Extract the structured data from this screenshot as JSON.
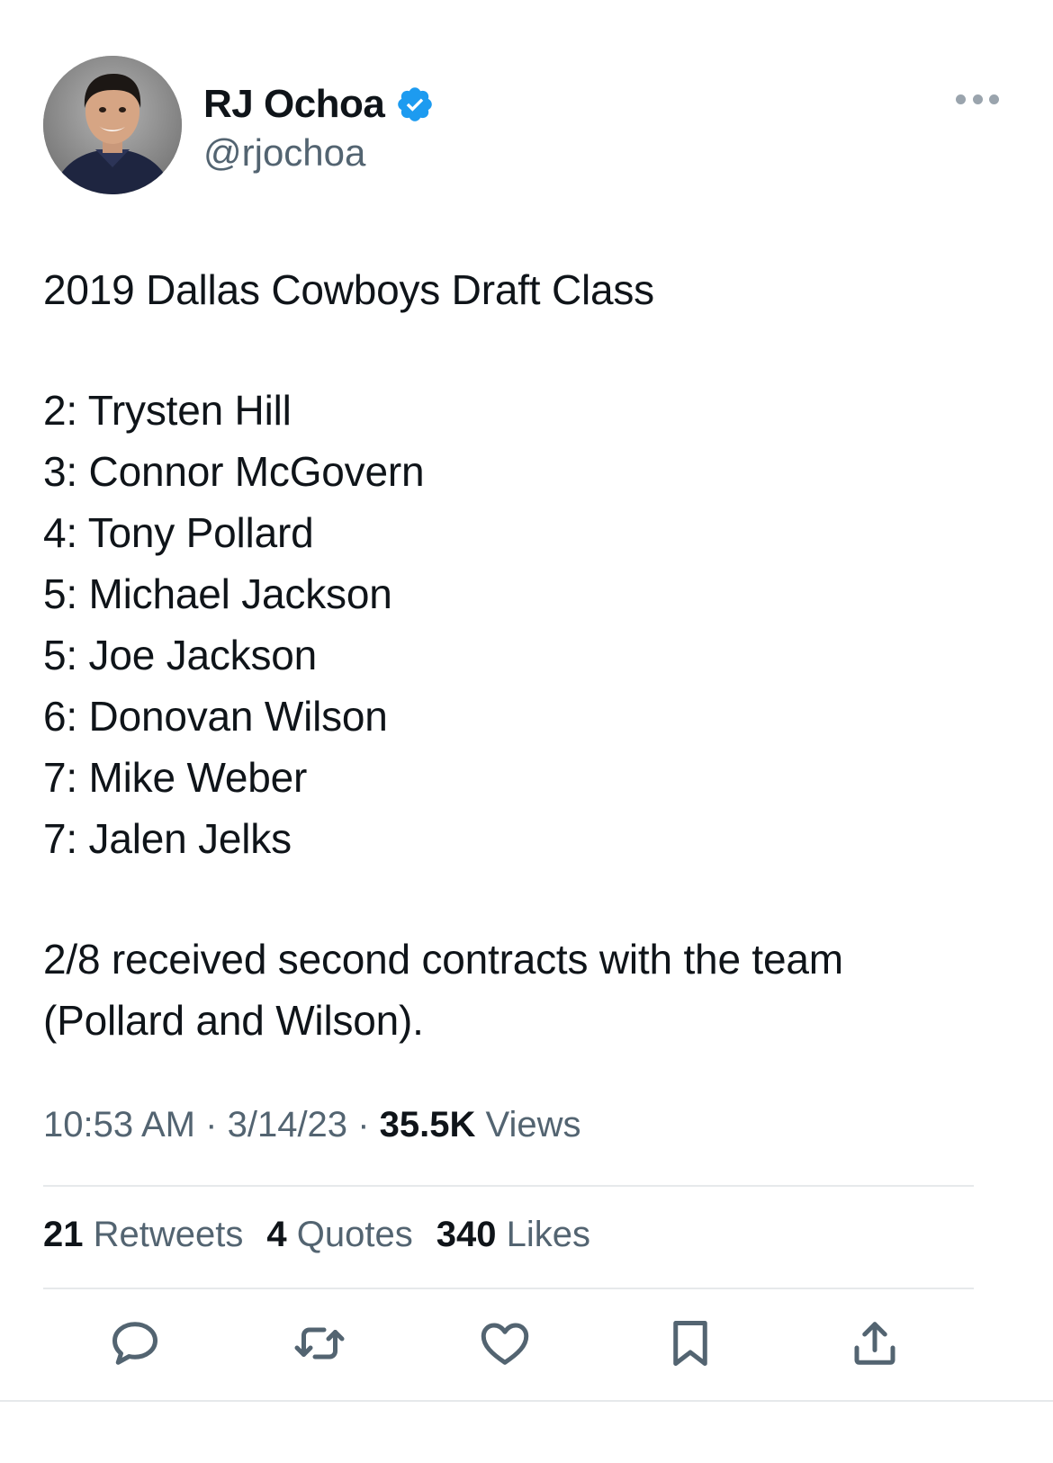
{
  "tweet": {
    "author": {
      "display_name": "RJ Ochoa",
      "handle": "@rjochoa",
      "verified": true
    },
    "text": {
      "headline": "2019 Dallas Cowboys Draft Class",
      "picks": [
        "2: Trysten Hill",
        "3: Connor McGovern",
        "4: Tony Pollard",
        "5: Michael Jackson",
        "5: Joe Jackson",
        "6: Donovan Wilson",
        "7: Mike Weber",
        "7: Jalen Jelks"
      ],
      "closing": [
        "2/8 received second contracts with the team",
        "(Pollard and Wilson)."
      ]
    },
    "meta": {
      "time": "10:53 AM",
      "separator": "·",
      "date": "3/14/23",
      "views_count": "35.5K",
      "views_label": "Views"
    },
    "stats": {
      "retweets_count": "21",
      "retweets_label": "Retweets",
      "quotes_count": "4",
      "quotes_label": "Quotes",
      "likes_count": "340",
      "likes_label": "Likes"
    },
    "actions": [
      "reply-icon",
      "retweet-icon",
      "like-icon",
      "bookmark-icon",
      "share-icon"
    ]
  },
  "colors": {
    "text_primary": "#0f1419",
    "text_secondary": "#536471",
    "verified_blue": "#1d9bf0",
    "icon_gray": "#536471",
    "divider": "#e6e9eb"
  }
}
